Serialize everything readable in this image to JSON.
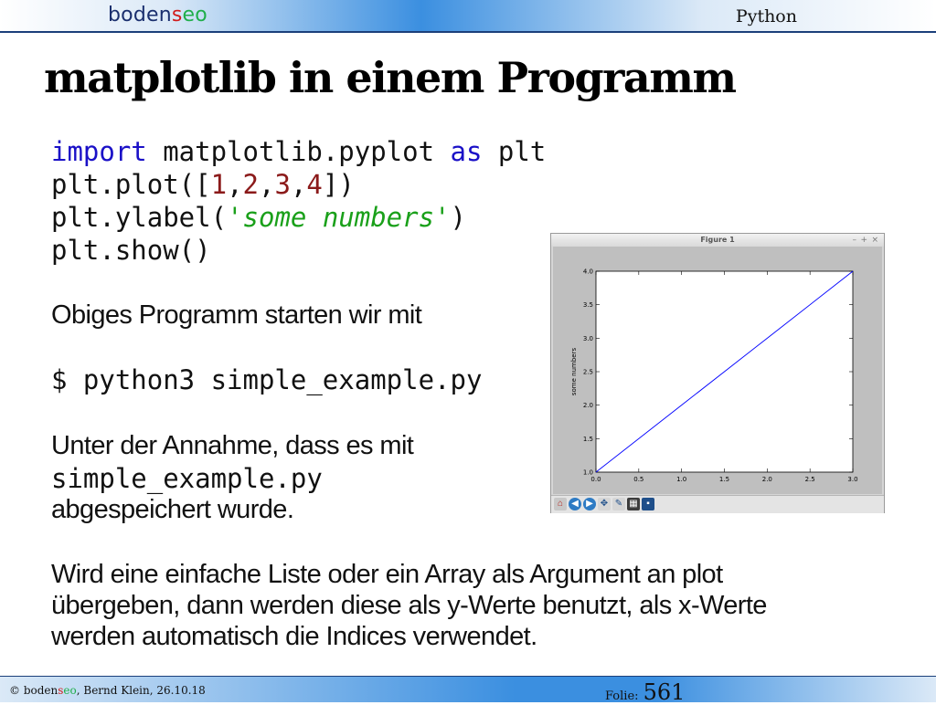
{
  "header": {
    "brand_prefix": "boden",
    "brand_s": "s",
    "brand_suffix": "eo",
    "topic": "Python"
  },
  "title": "matplotlib in einem Programm",
  "code": {
    "l1_kw1": "import",
    "l1_mod": " matplotlib.pyplot ",
    "l1_kw2": "as",
    "l1_alias": " plt",
    "l2_a": "plt.plot([",
    "l2_n1": "1",
    "l2_c1": ",",
    "l2_n2": "2",
    "l2_c2": ",",
    "l2_n3": "3",
    "l2_c3": ",",
    "l2_n4": "4",
    "l2_b": "])",
    "l3_a": "plt.ylabel(",
    "l3_str": "'some numbers'",
    "l3_b": ")",
    "l4": "plt.show()"
  },
  "text": {
    "start_line": "Obiges Programm starten wir mit",
    "command": "$ python3 simple_example.py",
    "assume_line1": "Unter der Annahme, dass es mit",
    "assume_file": "simple_example.py",
    "assume_line2": "abgespeichert wurde.",
    "explain1": "Wird eine einfache Liste oder ein Array als Argument an plot",
    "explain2": "übergeben, dann werden diese als y-Werte benutzt, als x-Werte",
    "explain3": "werden automatisch die Indices verwendet."
  },
  "figure_window": {
    "title": "Figure 1",
    "minimize": "–",
    "maximize": "+",
    "close": "×",
    "toolbar_icons": [
      "home-icon",
      "back-icon",
      "forward-icon",
      "pan-icon",
      "zoom-icon",
      "configure-subplots-icon",
      "save-icon"
    ]
  },
  "chart_data": {
    "type": "line",
    "x": [
      0,
      1,
      2,
      3
    ],
    "series": [
      {
        "values": [
          1,
          2,
          3,
          4
        ],
        "color": "#0000ff"
      }
    ],
    "xlabel": "",
    "ylabel": "some numbers",
    "xlim": [
      0,
      3
    ],
    "ylim": [
      1,
      4
    ],
    "xticks": [
      "0.0",
      "0.5",
      "1.0",
      "1.5",
      "2.0",
      "2.5",
      "3.0"
    ],
    "yticks": [
      "1.0",
      "1.5",
      "2.0",
      "2.5",
      "3.0",
      "3.5",
      "4.0"
    ],
    "grid": false
  },
  "footer": {
    "copyright": "©",
    "brand_prefix": "boden",
    "brand_s": "s",
    "brand_suffix": "eo",
    "author_date": ", Bernd Klein, 26.10.18",
    "folie_label": "Folie:",
    "folie_number": "561"
  }
}
